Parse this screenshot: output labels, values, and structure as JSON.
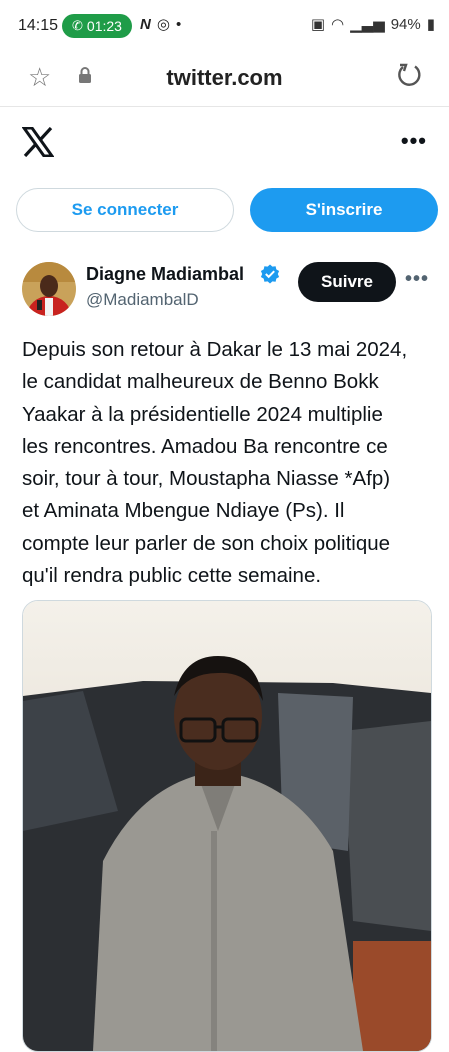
{
  "status_bar": {
    "time": "14:15",
    "call_timer": "01:23",
    "battery": "94%",
    "icons_left": [
      "n-logo-icon",
      "whatsapp-icon",
      "dot-icon"
    ],
    "icons_right": [
      "alarm-icon",
      "wifi-icon",
      "signal-icon",
      "battery-icon"
    ]
  },
  "browser": {
    "url": "twitter.com"
  },
  "header": {
    "logo": "x-logo-icon",
    "more": "•••"
  },
  "auth": {
    "login_label": "Se connecter",
    "signup_label": "S'inscrire"
  },
  "tweet": {
    "author_name": "Diagne Madiambal",
    "author_handle": "@MadiambalD",
    "follow_label": "Suivre",
    "more": "•••",
    "text": "Depuis son retour à Dakar le 13 mai 2024,\nle candidat malheureux de Benno Bokk\nYaakar à la présidentielle 2024 multiplie\nles rencontres. Amadou Ba rencontre ce\nsoir, tour à tour, Moustapha Niasse *Afp)\net Aminata Mbengue Ndiaye (Ps). Il\ncompte leur parler de son choix politique\nqu'il rendra public cette semaine."
  },
  "colors": {
    "accent": "#1d9bf0",
    "text": "#0f1419",
    "secondary": "#536471",
    "call_green": "#1f9c48"
  }
}
